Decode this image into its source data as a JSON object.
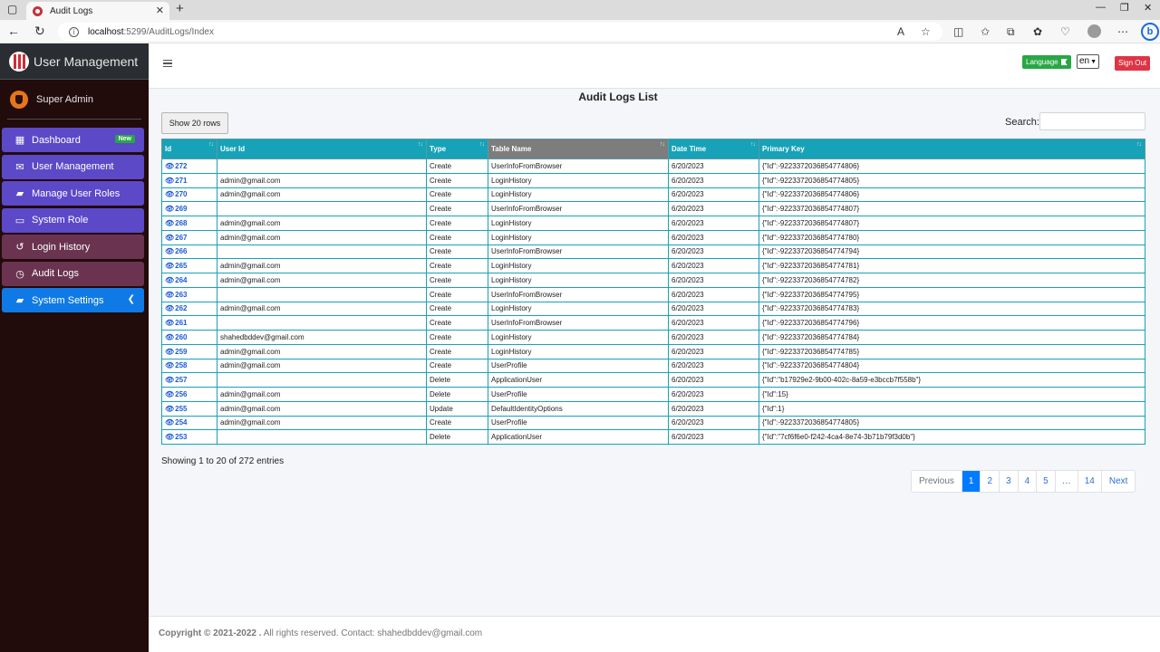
{
  "browser": {
    "tab_title": "Audit Logs",
    "url_host": "localhost",
    "url_path": ":5299/AuditLogs/Index"
  },
  "sidebar": {
    "brand": "User Management",
    "user": "Super Admin",
    "items": [
      {
        "label": "Dashboard",
        "icon": "grid-icon",
        "badge": "New"
      },
      {
        "label": "User Management",
        "icon": "envelope-icon"
      },
      {
        "label": "Manage User Roles",
        "icon": "briefcase-icon"
      },
      {
        "label": "System Role",
        "icon": "monitor-icon"
      },
      {
        "label": "Login History",
        "icon": "history-icon"
      },
      {
        "label": "Audit Logs",
        "icon": "clock-icon"
      },
      {
        "label": "System Settings",
        "icon": "toolbox-icon"
      }
    ]
  },
  "topnav": {
    "language_label": "Language",
    "language_value": "en",
    "signout_label": "Sign Out"
  },
  "page": {
    "title": "Audit Logs List",
    "show_rows_label": "Show 20 rows",
    "search_label": "Search:",
    "search_value": ""
  },
  "table": {
    "headers": [
      "Id",
      "User Id",
      "Type",
      "Table Name",
      "Date Time",
      "Primary Key"
    ],
    "rows": [
      {
        "id": "272",
        "user": "",
        "type": "Create",
        "table": "UserInfoFromBrowser",
        "date": "6/20/2023",
        "key": "{\"Id\":-9223372036854774806}"
      },
      {
        "id": "271",
        "user": "admin@gmail.com",
        "type": "Create",
        "table": "LoginHistory",
        "date": "6/20/2023",
        "key": "{\"Id\":-9223372036854774805}"
      },
      {
        "id": "270",
        "user": "admin@gmail.com",
        "type": "Create",
        "table": "LoginHistory",
        "date": "6/20/2023",
        "key": "{\"Id\":-9223372036854774806}"
      },
      {
        "id": "269",
        "user": "",
        "type": "Create",
        "table": "UserInfoFromBrowser",
        "date": "6/20/2023",
        "key": "{\"Id\":-9223372036854774807}"
      },
      {
        "id": "268",
        "user": "admin@gmail.com",
        "type": "Create",
        "table": "LoginHistory",
        "date": "6/20/2023",
        "key": "{\"Id\":-9223372036854774807}"
      },
      {
        "id": "267",
        "user": "admin@gmail.com",
        "type": "Create",
        "table": "LoginHistory",
        "date": "6/20/2023",
        "key": "{\"Id\":-9223372036854774780}"
      },
      {
        "id": "266",
        "user": "",
        "type": "Create",
        "table": "UserInfoFromBrowser",
        "date": "6/20/2023",
        "key": "{\"Id\":-9223372036854774794}"
      },
      {
        "id": "265",
        "user": "admin@gmail.com",
        "type": "Create",
        "table": "LoginHistory",
        "date": "6/20/2023",
        "key": "{\"Id\":-9223372036854774781}"
      },
      {
        "id": "264",
        "user": "admin@gmail.com",
        "type": "Create",
        "table": "LoginHistory",
        "date": "6/20/2023",
        "key": "{\"Id\":-9223372036854774782}"
      },
      {
        "id": "263",
        "user": "",
        "type": "Create",
        "table": "UserInfoFromBrowser",
        "date": "6/20/2023",
        "key": "{\"Id\":-9223372036854774795}"
      },
      {
        "id": "262",
        "user": "admin@gmail.com",
        "type": "Create",
        "table": "LoginHistory",
        "date": "6/20/2023",
        "key": "{\"Id\":-9223372036854774783}"
      },
      {
        "id": "261",
        "user": "",
        "type": "Create",
        "table": "UserInfoFromBrowser",
        "date": "6/20/2023",
        "key": "{\"Id\":-9223372036854774796}"
      },
      {
        "id": "260",
        "user": "shahedbddev@gmail.com",
        "type": "Create",
        "table": "LoginHistory",
        "date": "6/20/2023",
        "key": "{\"Id\":-9223372036854774784}"
      },
      {
        "id": "259",
        "user": "admin@gmail.com",
        "type": "Create",
        "table": "LoginHistory",
        "date": "6/20/2023",
        "key": "{\"Id\":-9223372036854774785}"
      },
      {
        "id": "258",
        "user": "admin@gmail.com",
        "type": "Create",
        "table": "UserProfile",
        "date": "6/20/2023",
        "key": "{\"Id\":-9223372036854774804}"
      },
      {
        "id": "257",
        "user": "",
        "type": "Delete",
        "table": "ApplicationUser",
        "date": "6/20/2023",
        "key": "{\"Id\":\"b17929e2-9b00-402c-8a59-e3bccb7f558b\"}"
      },
      {
        "id": "256",
        "user": "admin@gmail.com",
        "type": "Delete",
        "table": "UserProfile",
        "date": "6/20/2023",
        "key": "{\"Id\":15}"
      },
      {
        "id": "255",
        "user": "admin@gmail.com",
        "type": "Update",
        "table": "DefaultIdentityOptions",
        "date": "6/20/2023",
        "key": "{\"Id\":1}"
      },
      {
        "id": "254",
        "user": "admin@gmail.com",
        "type": "Create",
        "table": "UserProfile",
        "date": "6/20/2023",
        "key": "{\"Id\":-9223372036854774805}"
      },
      {
        "id": "253",
        "user": "",
        "type": "Delete",
        "table": "ApplicationUser",
        "date": "6/20/2023",
        "key": "{\"Id\":\"7cf6f6e0-f242-4ca4-8e74-3b71b79f3d0b\"}"
      }
    ]
  },
  "summary": "Showing 1 to 20 of 272 entries",
  "pagination": [
    "Previous",
    "1",
    "2",
    "3",
    "4",
    "5",
    "…",
    "14",
    "Next"
  ],
  "footer": {
    "copyright": "Copyright © 2021-2022 .",
    "rest": " All rights reserved. Contact: shahedbddev@gmail.com"
  }
}
